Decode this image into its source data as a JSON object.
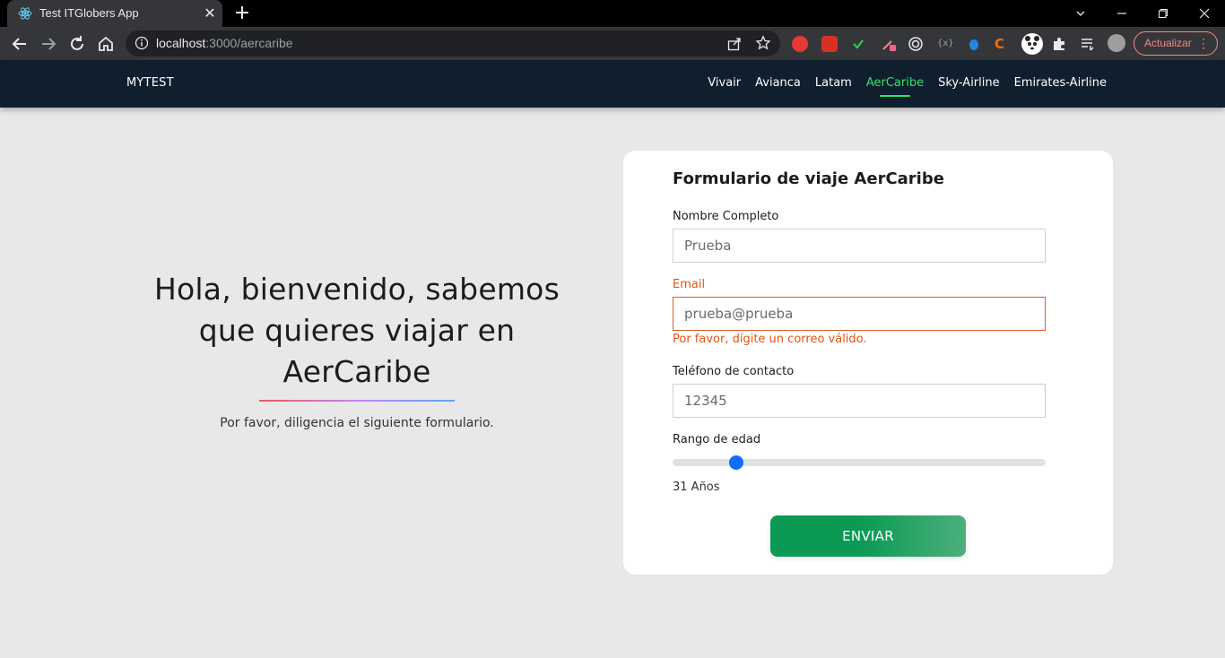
{
  "browser": {
    "tab_title": "Test ITGlobers App",
    "url_host": "localhost",
    "url_path": ":3000/aercaribe",
    "update_label": "Actualizar"
  },
  "navbar": {
    "brand": "MYTEST",
    "links": [
      "Vivair",
      "Avianca",
      "Latam",
      "AerCaribe",
      "Sky-Airline",
      "Emirates-Airline"
    ],
    "active_link": "AerCaribe",
    "active_color": "#2ee66b"
  },
  "hero": {
    "title": "Hola, bienvenido, sabemos que quieres viajar en AerCaribe",
    "subtitle": "Por favor, diligencia el siguiente formulario."
  },
  "form": {
    "title": "Formulario de viaje AerCaribe",
    "name_label": "Nombre Completo",
    "name_value": "Prueba",
    "email_label": "Email",
    "email_value": "prueba@prueba",
    "email_error": "Por favor, dígite un correo válido.",
    "phone_label": "Teléfono de contacto",
    "phone_value": "12345",
    "age_label": "Rango de edad",
    "age_slider_fraction": 0.17,
    "age_value": "31 Años",
    "submit_label": "ENVIAR",
    "error_color": "#e55314"
  }
}
